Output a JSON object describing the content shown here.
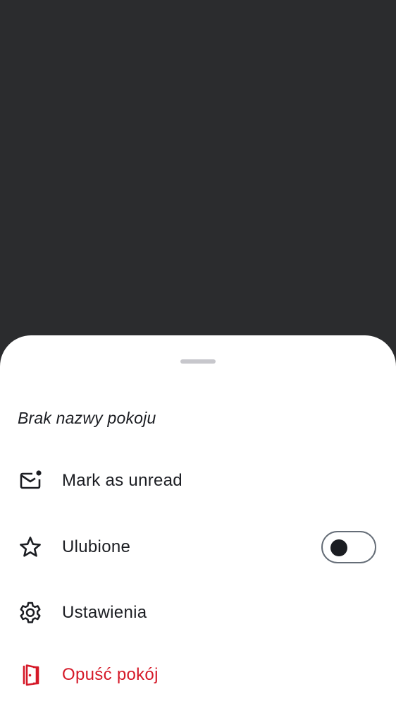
{
  "sheet": {
    "room_name": "Brak nazwy pokoju",
    "items": [
      {
        "label": "Mark as unread",
        "icon": "mail-unread-icon"
      },
      {
        "label": "Ulubione",
        "icon": "star-outline-icon",
        "toggle_on": false
      },
      {
        "label": "Ustawienia",
        "icon": "gear-icon"
      },
      {
        "label": "Opuść pokój",
        "icon": "leave-door-icon"
      }
    ]
  },
  "colors": {
    "scrim": "#2b2c2e",
    "text": "#1b1d22",
    "danger": "#d51928",
    "handle": "#c7c7cc",
    "toggle_border": "#656d77"
  }
}
